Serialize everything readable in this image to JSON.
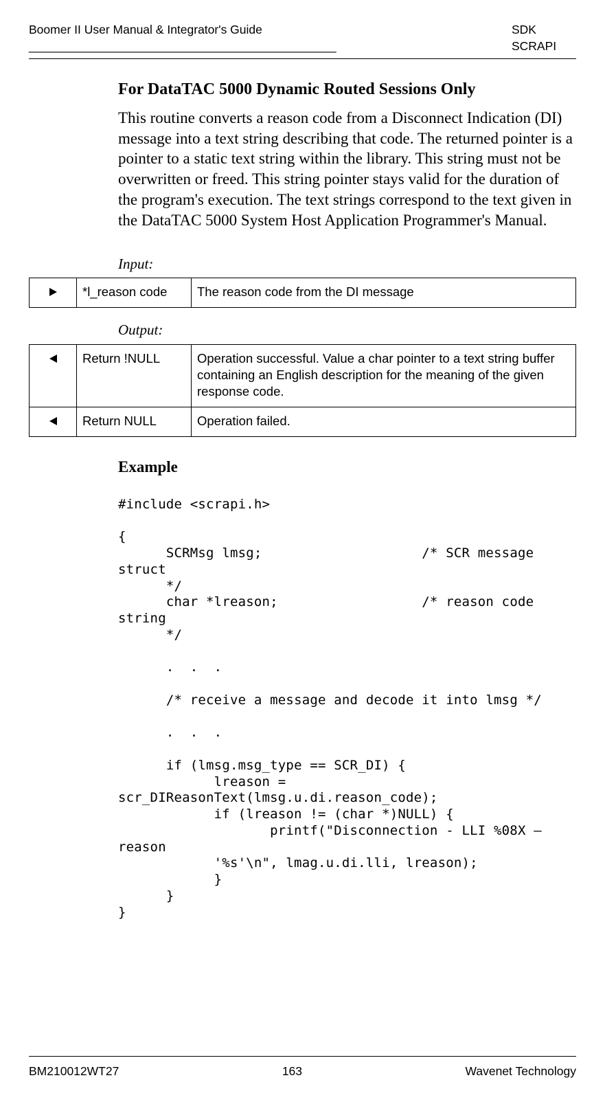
{
  "header": {
    "left": "Boomer II User Manual & Integrator's Guide",
    "right": "SDK SCRAPI"
  },
  "footer": {
    "left": "BM210012WT27",
    "center": "163",
    "right": "Wavenet Technology"
  },
  "title": "For DataTAC 5000 Dynamic Routed Sessions Only",
  "body": "This routine converts a reason code from a Disconnect Indication (DI) message into a text string describing that code. The returned pointer is a pointer to a static text string within the library. This string must not be overwritten or freed. This string pointer stays valid for the duration of the program's execution. The text strings correspond to the text given in the DataTAC 5000 System Host Application Programmer's Manual.",
  "input_label": "Input:",
  "input_rows": [
    {
      "key": "*l_reason code",
      "desc": "The reason code from the DI message"
    }
  ],
  "output_label": "Output:",
  "output_rows": [
    {
      "key": "Return !NULL",
      "desc": "Operation successful. Value a char pointer to a text string buffer containing an English description for the meaning of the given response code."
    },
    {
      "key": "Return NULL",
      "desc": "Operation failed."
    }
  ],
  "example_heading": "Example",
  "code": "#include <scrapi.h>\n\n{\n      SCRMsg lmsg;                    /* SCR message struct\n      */\n      char *lreason;                  /* reason code string\n      */\n\n      .  .  .\n\n      /* receive a message and decode it into lmsg */\n\n      .  .  .\n\n      if (lmsg.msg_type == SCR_DI) {\n            lreason = scr_DIReasonText(lmsg.u.di.reason_code);\n            if (lreason != (char *)NULL) {\n                   printf(\"Disconnection - LLI %08X – reason\n            '%s'\\n\", lmag.u.di.lli, lreason);\n            }\n      }\n}"
}
